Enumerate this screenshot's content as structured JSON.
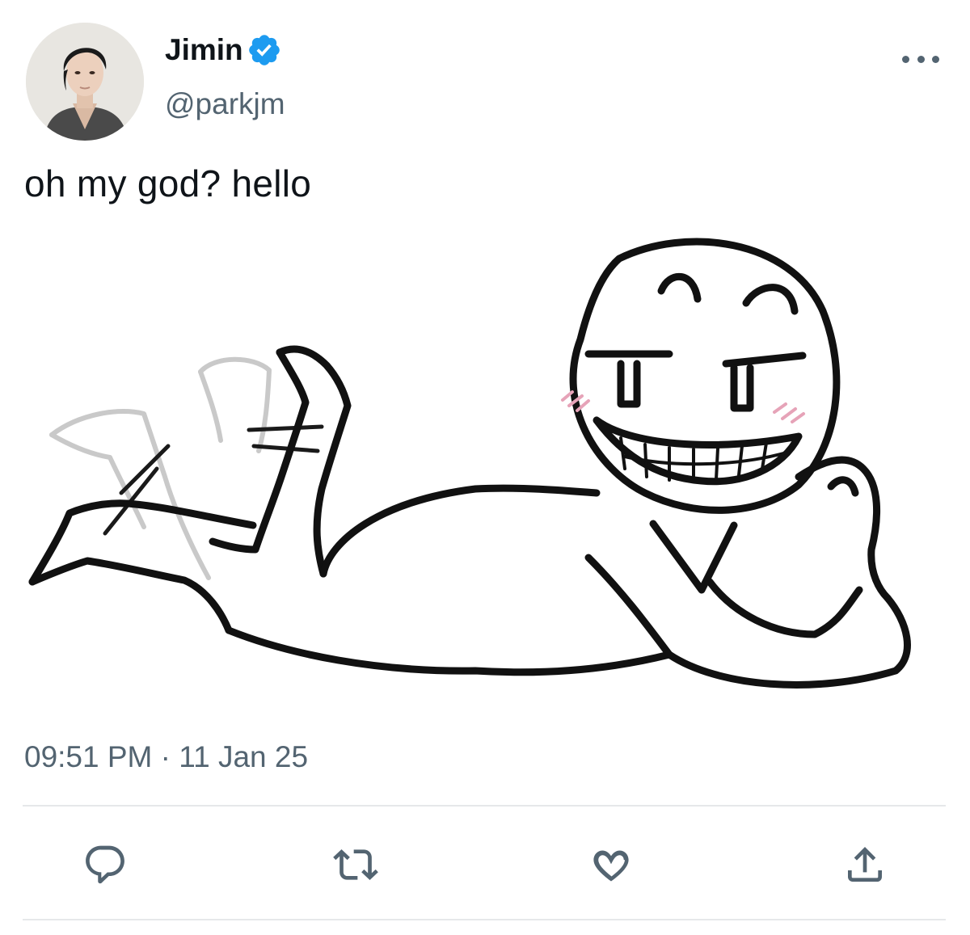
{
  "author": {
    "display_name": "Jimin",
    "handle": "@parkjm",
    "verified": true,
    "verified_color": "#1d9bf0"
  },
  "tweet": {
    "text": "oh my god? hello",
    "timestamp": "09:51 PM · 11 Jan 25"
  },
  "actions": [
    {
      "name": "reply",
      "icon": "reply-icon"
    },
    {
      "name": "retweet",
      "icon": "retweet-icon"
    },
    {
      "name": "like",
      "icon": "heart-icon"
    },
    {
      "name": "share",
      "icon": "share-icon"
    }
  ],
  "colors": {
    "text": "#0f1419",
    "secondary": "#536471",
    "divider": "#e6e8ea"
  }
}
